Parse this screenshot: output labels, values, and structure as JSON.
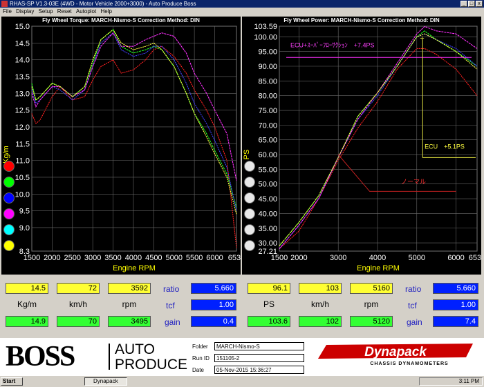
{
  "window": {
    "title": "RHAS-SP V1.3-03E  (4WD - Motor Vehicle 2000+3000) - Auto Produce Boss"
  },
  "menu": [
    "File",
    "Display",
    "Setup",
    "Reset",
    "Autoplot",
    "Help"
  ],
  "torque_panel": {
    "header": "Fly Wheel Torque: MARCH-Nismo-S     Correction Method: DIN",
    "ylabel": "Kg/m",
    "xlabel": "Engine RPM",
    "y_ticks": [
      "15.0",
      "14.5",
      "14.0",
      "13.5",
      "13.0",
      "12.5",
      "12.0",
      "11.5",
      "11.0",
      "10.5",
      "10.0",
      "9.5",
      "9.0",
      "8.3"
    ],
    "x_ticks": [
      "1500",
      "2000",
      "2500",
      "3000",
      "3500",
      "4000",
      "4500",
      "5000",
      "5500",
      "6000",
      "6536"
    ]
  },
  "power_panel": {
    "header": "Fly Wheel Power: MARCH-Nismo-S     Correction Method: DIN",
    "ylabel": "PS",
    "xlabel": "Engine RPM",
    "y_ticks": [
      "103.59",
      "100.00",
      "95.00",
      "90.00",
      "85.00",
      "80.00",
      "75.00",
      "70.00",
      "65.00",
      "60.00",
      "55.00",
      "50.00",
      "45.00",
      "40.00",
      "35.00",
      "30.00",
      "27.21"
    ],
    "x_ticks": [
      "1500",
      "2000",
      "3000",
      "4000",
      "5000",
      "6000",
      "6536"
    ],
    "annotations": [
      "ECU+ｽｰﾊﾟｰﾌﾛｰｻｸｼｮﾝ　+7.4PS",
      "ECU　+5.1PS",
      "ノーマル"
    ]
  },
  "legend_colors": [
    "#ff0000",
    "#00ff00",
    "#0000ff",
    "#ff00ff",
    "#00ffff",
    "#ffff00"
  ],
  "torque_readout": {
    "top": [
      "14.5",
      "72",
      "3592"
    ],
    "units": [
      "Kg/m",
      "km/h",
      "rpm"
    ],
    "bottom": [
      "14.9",
      "70",
      "3495"
    ],
    "ratio_label": "ratio",
    "ratio": "5.660",
    "tcf_label": "tcf",
    "tcf": "1.00",
    "gain_label": "gain",
    "gain": "0.4"
  },
  "power_readout": {
    "top": [
      "96.1",
      "103",
      "5160"
    ],
    "units": [
      "PS",
      "km/h",
      "rpm"
    ],
    "bottom": [
      "103.6",
      "102",
      "5120"
    ],
    "ratio_label": "ratio",
    "ratio": "5.660",
    "tcf_label": "tcf",
    "tcf": "1.00",
    "gain_label": "gain",
    "gain": "7.4"
  },
  "footer": {
    "brand": "BOSS",
    "brand_sub_1": "AUTO",
    "brand_sub_2": "PRODUCE",
    "folder_label": "Folder",
    "folder": "MARCH-Nismo-S",
    "runid_label": "Run ID",
    "runid": "151105-2",
    "date_label": "Date",
    "date": "05-Nov-2015   15:36:27",
    "dyna": "Dynapack",
    "dyna_sub": "CHASSIS DYNAMOMETERS"
  },
  "taskbar": {
    "start": "Start",
    "task": "Dynapack",
    "clock": "3:11 PM"
  },
  "chart_data": [
    {
      "type": "line",
      "title": "Fly Wheel Torque: MARCH-Nismo-S     Correction Method: DIN",
      "xlabel": "Engine RPM",
      "ylabel": "Kg/m",
      "xlim": [
        1500,
        6536
      ],
      "ylim": [
        8.3,
        15.0
      ],
      "series": [
        {
          "color": "#ff2020",
          "x": [
            1500,
            1600,
            1700,
            2000,
            2200,
            2500,
            2800,
            3000,
            3200,
            3500,
            3700,
            4000,
            4300,
            4500,
            4700,
            5000,
            5300,
            5500,
            5800,
            6000,
            6300,
            6536
          ],
          "y": [
            12.4,
            12.1,
            12.2,
            12.9,
            13.2,
            12.8,
            12.9,
            13.4,
            13.8,
            14.0,
            13.6,
            13.7,
            14.0,
            14.3,
            14.4,
            14.1,
            13.6,
            13.1,
            12.5,
            12.0,
            11.0,
            8.4
          ]
        },
        {
          "color": "#20ff20",
          "x": [
            1500,
            1600,
            1700,
            2000,
            2200,
            2500,
            2800,
            3000,
            3200,
            3500,
            3700,
            4000,
            4300,
            4500,
            4700,
            5000,
            5300,
            5500,
            5800,
            6000,
            6300,
            6536
          ],
          "y": [
            13.3,
            12.8,
            12.9,
            13.3,
            13.2,
            12.9,
            13.2,
            13.9,
            14.6,
            14.9,
            14.4,
            14.2,
            14.3,
            14.4,
            14.3,
            13.8,
            13.0,
            12.4,
            11.8,
            11.3,
            10.6,
            9.6
          ]
        },
        {
          "color": "#4040ff",
          "x": [
            1500,
            1600,
            1700,
            2000,
            2200,
            2500,
            2800,
            3000,
            3200,
            3500,
            3700,
            4000,
            4300,
            4500,
            4700,
            5000,
            5300,
            5500,
            5800,
            6000,
            6300,
            6536
          ],
          "y": [
            13.1,
            12.7,
            12.8,
            13.2,
            13.1,
            12.8,
            13.1,
            13.8,
            14.5,
            14.8,
            14.3,
            14.1,
            14.2,
            14.4,
            14.4,
            14.0,
            13.3,
            12.7,
            12.1,
            11.6,
            10.8,
            9.5
          ]
        },
        {
          "color": "#ff30ff",
          "x": [
            1500,
            1600,
            1700,
            2000,
            2200,
            2500,
            2800,
            3000,
            3200,
            3500,
            3700,
            4000,
            4300,
            4500,
            4700,
            5000,
            5300,
            5500,
            5800,
            6000,
            6300,
            6536
          ],
          "y": [
            13.0,
            12.6,
            12.8,
            13.2,
            13.2,
            12.9,
            13.1,
            13.8,
            14.4,
            14.8,
            14.4,
            14.4,
            14.6,
            14.7,
            14.8,
            14.7,
            14.2,
            13.6,
            13.0,
            12.5,
            11.8,
            10.4
          ]
        },
        {
          "color": "#ffff40",
          "x": [
            1500,
            1600,
            1700,
            2000,
            2200,
            2500,
            2800,
            3000,
            3200,
            3500,
            3700,
            4000,
            4300,
            4500,
            4700,
            5000,
            5300,
            5500,
            5800,
            6000,
            6300,
            6536
          ],
          "y": [
            13.2,
            12.8,
            12.9,
            13.3,
            13.2,
            12.9,
            13.2,
            14.0,
            14.6,
            14.9,
            14.5,
            14.3,
            14.4,
            14.5,
            14.3,
            13.8,
            13.0,
            12.4,
            11.7,
            11.2,
            10.5,
            9.4
          ]
        }
      ]
    },
    {
      "type": "line",
      "title": "Fly Wheel Power: MARCH-Nismo-S     Correction Method: DIN",
      "xlabel": "Engine RPM",
      "ylabel": "PS",
      "xlim": [
        1500,
        6536
      ],
      "ylim": [
        27.21,
        103.59
      ],
      "series": [
        {
          "color": "#ff2020",
          "x": [
            1500,
            2000,
            2500,
            3000,
            3500,
            4000,
            4500,
            5000,
            5200,
            5500,
            6000,
            6536
          ],
          "y": [
            28,
            34,
            45,
            58,
            69,
            78,
            89,
            96,
            96,
            94,
            89,
            80
          ]
        },
        {
          "color": "#20ff20",
          "x": [
            1500,
            2000,
            2500,
            3000,
            3500,
            4000,
            4500,
            5000,
            5200,
            5500,
            6000,
            6536
          ],
          "y": [
            29,
            37,
            46,
            59,
            73,
            81,
            90,
            100,
            102,
            99,
            95,
            90
          ]
        },
        {
          "color": "#4040ff",
          "x": [
            1500,
            2000,
            2500,
            3000,
            3500,
            4000,
            4500,
            5000,
            5200,
            5500,
            6000,
            6536
          ],
          "y": [
            28,
            36,
            45,
            59,
            72,
            80,
            90,
            100,
            101,
            99,
            96,
            90
          ]
        },
        {
          "color": "#ff30ff",
          "x": [
            1500,
            2000,
            2500,
            3000,
            3500,
            4000,
            4500,
            5000,
            5200,
            5500,
            6000,
            6536
          ],
          "y": [
            28,
            36,
            45,
            59,
            72,
            81,
            91,
            101,
            103.5,
            102,
            101,
            96
          ]
        },
        {
          "color": "#ffff40",
          "x": [
            1500,
            2000,
            2500,
            3000,
            3500,
            4000,
            4500,
            5000,
            5200,
            5500,
            6000,
            6536
          ],
          "y": [
            29,
            37,
            46,
            59,
            73,
            81,
            90,
            100,
            101,
            99,
            95,
            89
          ]
        }
      ]
    }
  ]
}
